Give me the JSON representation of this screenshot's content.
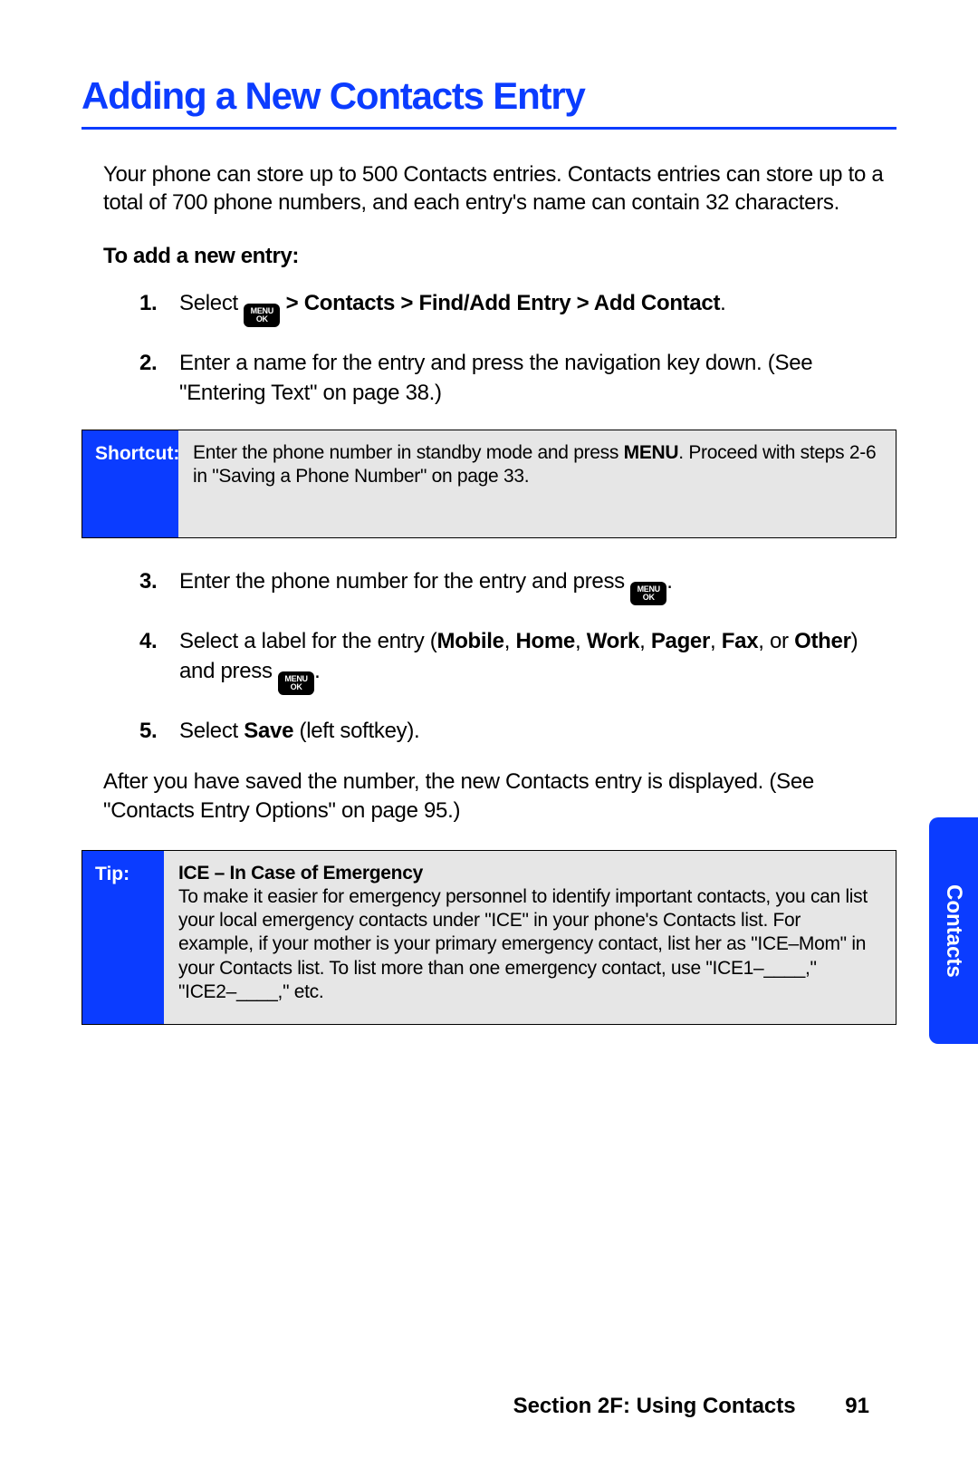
{
  "title": "Adding a New Contacts Entry",
  "intro": "Your phone can store up to 500 Contacts entries. Contacts entries can store up to a total of 700 phone numbers, and each entry's name can contain 32 characters.",
  "subhead": "To add a new entry:",
  "steps": {
    "s1_num": "1.",
    "s1_select": "Select ",
    "s1_path": " > Contacts > Find/Add Entry > Add Contact",
    "s1_dot": ".",
    "s2_num": "2.",
    "s2": "Enter a name for the entry and press the navigation key down. (See \"Entering Text\" on page 38.)",
    "s3_num": "3.",
    "s3_pre": "Enter the phone number for the entry and press ",
    "s3_dot": ".",
    "s4_num": "4.",
    "s4_pre": "Select a label for the entry (",
    "s4_m": "Mobile",
    "s4_c1": ", ",
    "s4_h": "Home",
    "s4_c2": ",  ",
    "s4_w": "Work",
    "s4_c3": ", ",
    "s4_p": "Pager",
    "s4_c4": ", ",
    "s4_f": "Fax",
    "s4_or": ", or ",
    "s4_o": "Other",
    "s4_post": ") and press ",
    "s4_dot": ".",
    "s5_num": "5.",
    "s5_pre": "Select ",
    "s5_save": "Save",
    "s5_post": " (left softkey)."
  },
  "shortcut": {
    "label": "Shortcut:",
    "pre": "Enter the phone number in standby mode and press ",
    "menu": "MENU",
    "post": ". Proceed with steps 2-6 in \"Saving a Phone Number\" on page 33."
  },
  "after": "After you have saved the number, the new Contacts entry is displayed. (See \"Contacts Entry Options\" on page 95.)",
  "tip": {
    "label": "Tip:",
    "title": "ICE – In Case of Emergency",
    "body": "To make it easier for emergency personnel to identify important contacts, you can list your local emergency contacts under \"ICE\" in your phone's Contacts list. For example, if your mother is your primary emergency contact, list her as \"ICE–Mom\" in your Contacts list. To list more than one emergency contact, use \"ICE1–____,\" \"ICE2–____,\" etc."
  },
  "footer": {
    "section": "Section 2F: Using Contacts",
    "page": "91"
  },
  "sidetab": "Contacts",
  "menukey": {
    "top": "MENU",
    "bottom": "OK"
  }
}
